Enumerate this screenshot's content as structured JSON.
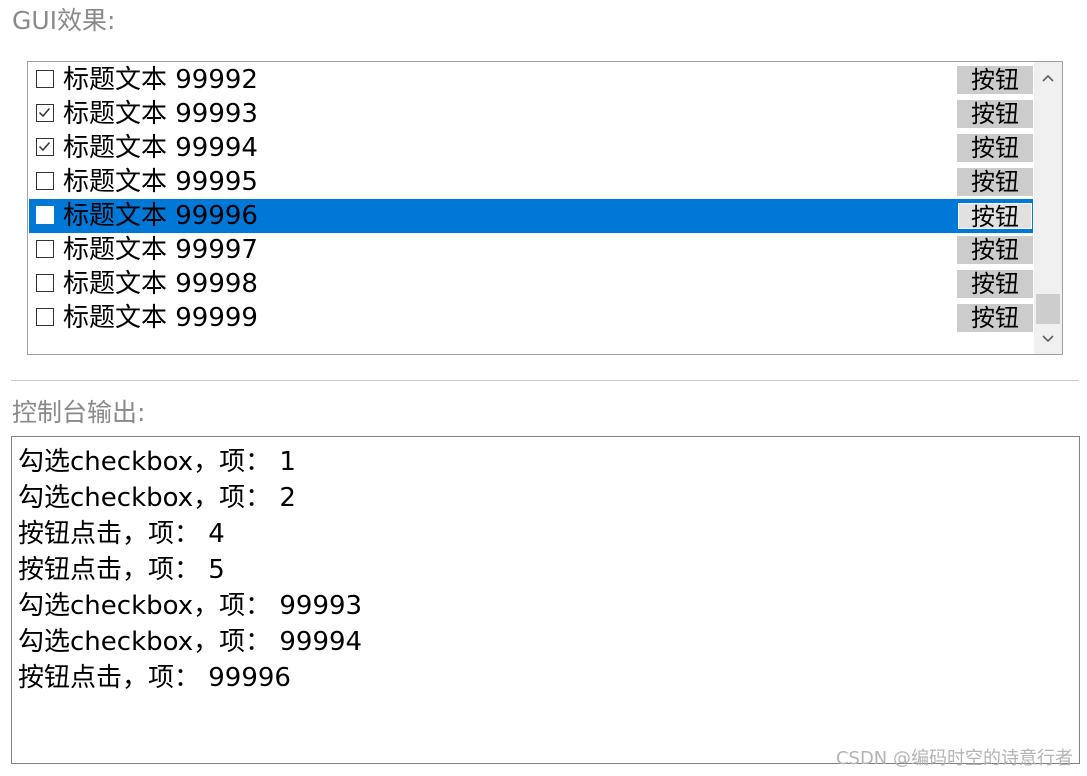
{
  "labels": {
    "gui": "GUI效果:",
    "console": "控制台输出:"
  },
  "list": {
    "items": [
      {
        "label": "标题文本 99992",
        "checked": false,
        "selected": false,
        "button": "按钮"
      },
      {
        "label": "标题文本 99993",
        "checked": true,
        "selected": false,
        "button": "按钮"
      },
      {
        "label": "标题文本 99994",
        "checked": true,
        "selected": false,
        "button": "按钮"
      },
      {
        "label": "标题文本 99995",
        "checked": false,
        "selected": false,
        "button": "按钮"
      },
      {
        "label": "标题文本 99996",
        "checked": false,
        "selected": true,
        "button": "按钮"
      },
      {
        "label": "标题文本 99997",
        "checked": false,
        "selected": false,
        "button": "按钮"
      },
      {
        "label": "标题文本 99998",
        "checked": false,
        "selected": false,
        "button": "按钮"
      },
      {
        "label": "标题文本 99999",
        "checked": false,
        "selected": false,
        "button": "按钮"
      }
    ]
  },
  "console": {
    "lines": [
      "勾选checkbox，项： 1",
      "勾选checkbox，项： 2",
      "按钮点击，项： 4",
      "按钮点击，项： 5",
      "勾选checkbox，项： 99993",
      "勾选checkbox，项： 99994",
      "按钮点击，项： 99996"
    ]
  },
  "watermark": "CSDN @编码时空的诗意行者",
  "colors": {
    "selection": "#0078d7",
    "row_button": "#cccccc",
    "section_label": "#8a8a8a"
  },
  "icons": {
    "scroll_up": "chevron-up-icon",
    "scroll_down": "chevron-down-icon",
    "checkbox_tick": "check-icon"
  }
}
